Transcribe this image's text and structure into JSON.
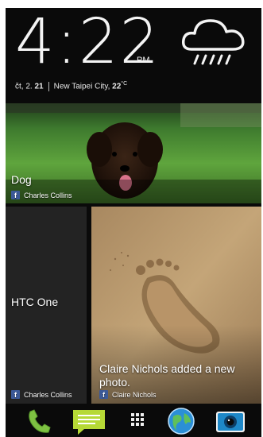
{
  "clock": {
    "time": "4:22",
    "ampm": "PM",
    "day": "čt, 2.",
    "day_num": "21",
    "location": "New Taipei City,",
    "temp": "22",
    "temp_unit": "°C",
    "weather_icon": "rain-cloud-icon"
  },
  "tiles": [
    {
      "caption": "Dog",
      "author": "Charles Collins",
      "source_icon": "facebook-icon"
    },
    {
      "caption": "HTC One",
      "author": "Charles Collins",
      "source_icon": "facebook-icon"
    },
    {
      "caption": "Claire Nichols added a new photo.",
      "author": "Claire Nichols",
      "source_icon": "facebook-icon"
    }
  ],
  "dock": [
    {
      "icon": "phone-icon"
    },
    {
      "icon": "messages-icon"
    },
    {
      "icon": "app-drawer-icon"
    },
    {
      "icon": "browser-globe-icon"
    },
    {
      "icon": "camera-icon"
    }
  ],
  "colors": {
    "facebook": "#3b5998",
    "phone_green": "#7ec242",
    "message_green": "#b6d936"
  }
}
